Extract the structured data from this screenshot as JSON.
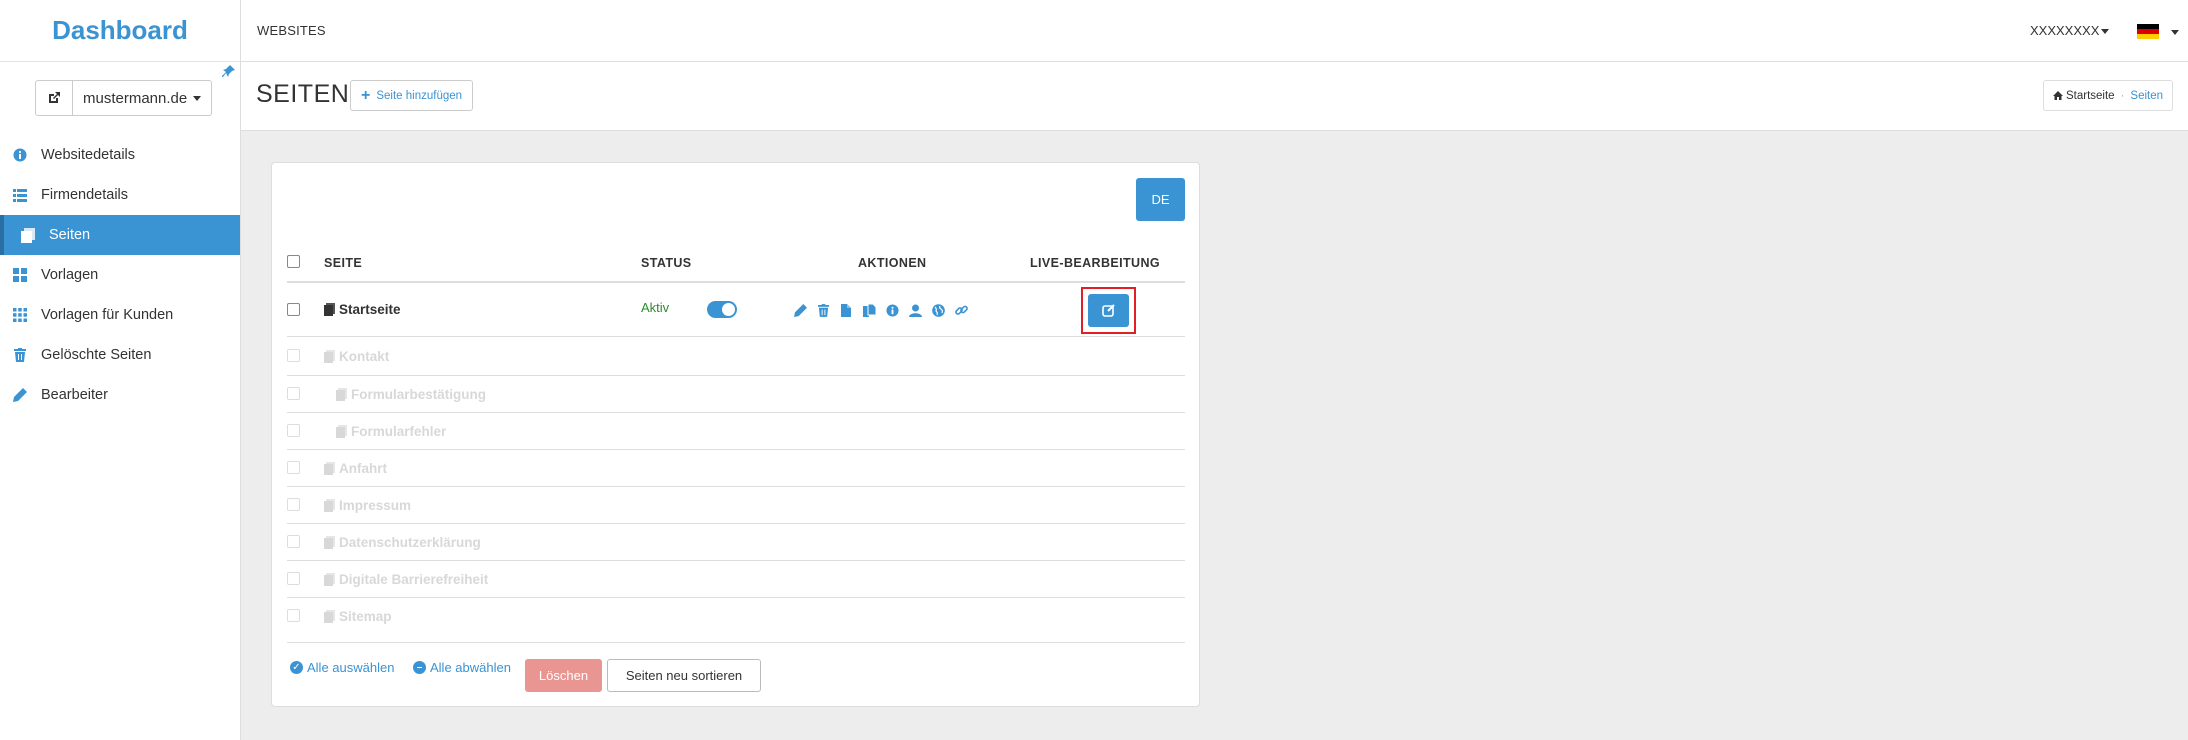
{
  "colors": {
    "primary": "#3a93d2",
    "danger": "#e99591",
    "success": "#2e8b2e",
    "highlight": "#e01f26"
  },
  "sidebar": {
    "brand": "Dashboard",
    "site_select": {
      "value": "mustermann.de"
    },
    "items": [
      {
        "label": "Websitedetails",
        "icon": "info-circle-icon",
        "active": false
      },
      {
        "label": "Firmendetails",
        "icon": "list-icon",
        "active": false
      },
      {
        "label": "Seiten",
        "icon": "pages-icon",
        "active": true
      },
      {
        "label": "Vorlagen",
        "icon": "grid-icon",
        "active": false
      },
      {
        "label": "Vorlagen für Kunden",
        "icon": "grid-small-icon",
        "active": false
      },
      {
        "label": "Gelöschte Seiten",
        "icon": "trash-icon",
        "active": false
      },
      {
        "label": "Bearbeiter",
        "icon": "pencil-icon",
        "active": false
      }
    ]
  },
  "topbar": {
    "nav": "WEBSITES",
    "user": "XXXXXXXX",
    "language_flag": "germany-flag-icon"
  },
  "header": {
    "title": "SEITEN",
    "add_button": "Seite hinzufügen",
    "breadcrumb": {
      "home": "Startseite",
      "current": "Seiten"
    }
  },
  "table": {
    "language_button": "DE",
    "columns": {
      "page": "SEITE",
      "status": "STATUS",
      "actions": "AKTIONEN",
      "live": "LIVE-BEARBEITUNG"
    },
    "rows": [
      {
        "label": "Startseite",
        "status": "Aktiv",
        "enabled": true,
        "level": 0
      },
      {
        "label": "Kontakt",
        "enabled": false,
        "level": 0
      },
      {
        "label": "Formularbestätigung",
        "enabled": false,
        "level": 1
      },
      {
        "label": "Formularfehler",
        "enabled": false,
        "level": 1
      },
      {
        "label": "Anfahrt",
        "enabled": false,
        "level": 0
      },
      {
        "label": "Impressum",
        "enabled": false,
        "level": 0
      },
      {
        "label": "Datenschutzerklärung",
        "enabled": false,
        "level": 0
      },
      {
        "label": "Digitale Barrierefreiheit",
        "enabled": false,
        "level": 0
      },
      {
        "label": "Sitemap",
        "enabled": false,
        "level": 0
      }
    ],
    "action_icons": [
      "pencil-icon",
      "trash-icon",
      "file-icon",
      "copy-icon",
      "info-icon",
      "user-icon",
      "globe-icon",
      "link-icon"
    ]
  },
  "footer": {
    "select_all": "Alle auswählen",
    "deselect_all": "Alle abwählen",
    "delete": "Löschen",
    "resort": "Seiten neu sortieren"
  }
}
